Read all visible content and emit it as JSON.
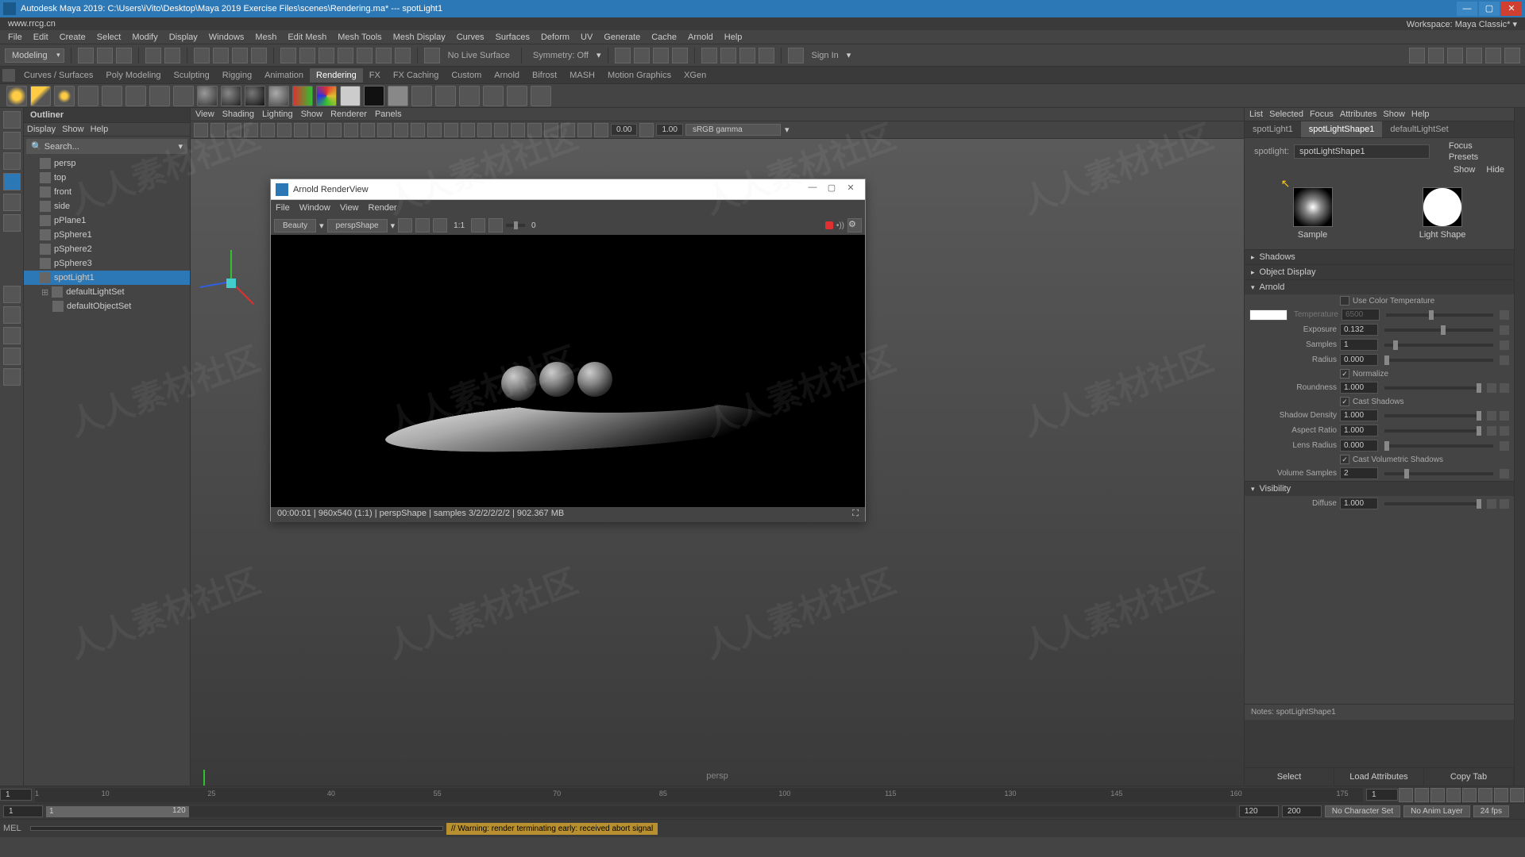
{
  "title": "Autodesk Maya 2019: C:\\Users\\iVito\\Desktop\\Maya 2019 Exercise Files\\scenes\\Rendering.ma*  ---  spotLight1",
  "workspace": {
    "label": "Workspace:",
    "value": "Maya Classic*"
  },
  "menus": [
    "File",
    "Edit",
    "Create",
    "Select",
    "Modify",
    "Display",
    "Windows",
    "Mesh",
    "Edit Mesh",
    "Mesh Tools",
    "Mesh Display",
    "Curves",
    "Surfaces",
    "Deform",
    "UV",
    "Generate",
    "Cache",
    "Arnold",
    "Help"
  ],
  "toolbar": {
    "mode": "Modeling",
    "live": "No Live Surface",
    "symmetry": "Symmetry: Off",
    "signin": "Sign In"
  },
  "shelves": [
    "Curves / Surfaces",
    "Poly Modeling",
    "Sculpting",
    "Rigging",
    "Animation",
    "Rendering",
    "FX",
    "FX Caching",
    "Custom",
    "Arnold",
    "Bifrost",
    "MASH",
    "Motion Graphics",
    "XGen"
  ],
  "outliner": {
    "title": "Outliner",
    "menu": [
      "Display",
      "Show",
      "Help"
    ],
    "search": "Search...",
    "items": [
      {
        "label": "persp",
        "dim": true
      },
      {
        "label": "top",
        "dim": true
      },
      {
        "label": "front",
        "dim": true
      },
      {
        "label": "side",
        "dim": true
      },
      {
        "label": "pPlane1"
      },
      {
        "label": "pSphere1"
      },
      {
        "label": "pSphere2"
      },
      {
        "label": "pSphere3"
      },
      {
        "label": "spotLight1",
        "sel": true
      },
      {
        "label": "defaultLightSet",
        "child": true
      },
      {
        "label": "defaultObjectSet",
        "child": true
      }
    ]
  },
  "vpmenu": [
    "View",
    "Shading",
    "Lighting",
    "Show",
    "Renderer",
    "Panels"
  ],
  "vp": {
    "v1": "0.00",
    "v2": "1.00",
    "cs": "sRGB gamma",
    "label": "persp"
  },
  "renderview": {
    "title": "Arnold RenderView",
    "menu": [
      "File",
      "Window",
      "View",
      "Render"
    ],
    "aov": "Beauty",
    "cam": "perspShape",
    "scale": "1:1",
    "val": "0",
    "status": "00:00:01 | 960x540 (1:1) | perspShape | samples 3/2/2/2/2/2 | 902.367 MB"
  },
  "attr": {
    "menu": [
      "List",
      "Selected",
      "Focus",
      "Attributes",
      "Show",
      "Help"
    ],
    "tabs": [
      "spotLight1",
      "spotLightShape1",
      "defaultLightSet"
    ],
    "nodelabel": "spotlight:",
    "node": "spotLightShape1",
    "btns": {
      "focus": "Focus",
      "presets": "Presets",
      "show": "Show",
      "hide": "Hide"
    },
    "swatches": {
      "sample": "Sample",
      "ls": "Light Shape"
    },
    "sections": {
      "shadows": "Shadows",
      "objdisp": "Object Display",
      "arnold": "Arnold",
      "visibility": "Visibility"
    },
    "arnold": {
      "usecolortemp": "Use Color Temperature",
      "temperature": {
        "lbl": "Temperature",
        "val": "6500"
      },
      "exposure": {
        "lbl": "Exposure",
        "val": "0.132"
      },
      "samples": {
        "lbl": "Samples",
        "val": "1"
      },
      "radius": {
        "lbl": "Radius",
        "val": "0.000"
      },
      "normalize": "Normalize",
      "roundness": {
        "lbl": "Roundness",
        "val": "1.000"
      },
      "castshadows": "Cast Shadows",
      "shadowdensity": {
        "lbl": "Shadow Density",
        "val": "1.000"
      },
      "aspect": {
        "lbl": "Aspect Ratio",
        "val": "1.000"
      },
      "lensradius": {
        "lbl": "Lens Radius",
        "val": "0.000"
      },
      "castvol": "Cast Volumetric Shadows",
      "volsamples": {
        "lbl": "Volume Samples",
        "val": "2"
      }
    },
    "visibility": {
      "diffuse": {
        "lbl": "Diffuse",
        "val": "1.000"
      }
    },
    "notes": "Notes: spotLightShape1",
    "foot": [
      "Select",
      "Load Attributes",
      "Copy Tab"
    ]
  },
  "timeline": {
    "start": "1",
    "end": "1",
    "cur": "1",
    "range_s": "1",
    "range_e": "120",
    "t2": "120",
    "fps": "24 fps",
    "nochar": "No Character Set",
    "noanim": "No Anim Layer",
    "r1": "120",
    "r2": "200"
  },
  "cmd": {
    "lbl": "MEL",
    "warn": "// Warning: render terminating early:  received abort signal"
  }
}
